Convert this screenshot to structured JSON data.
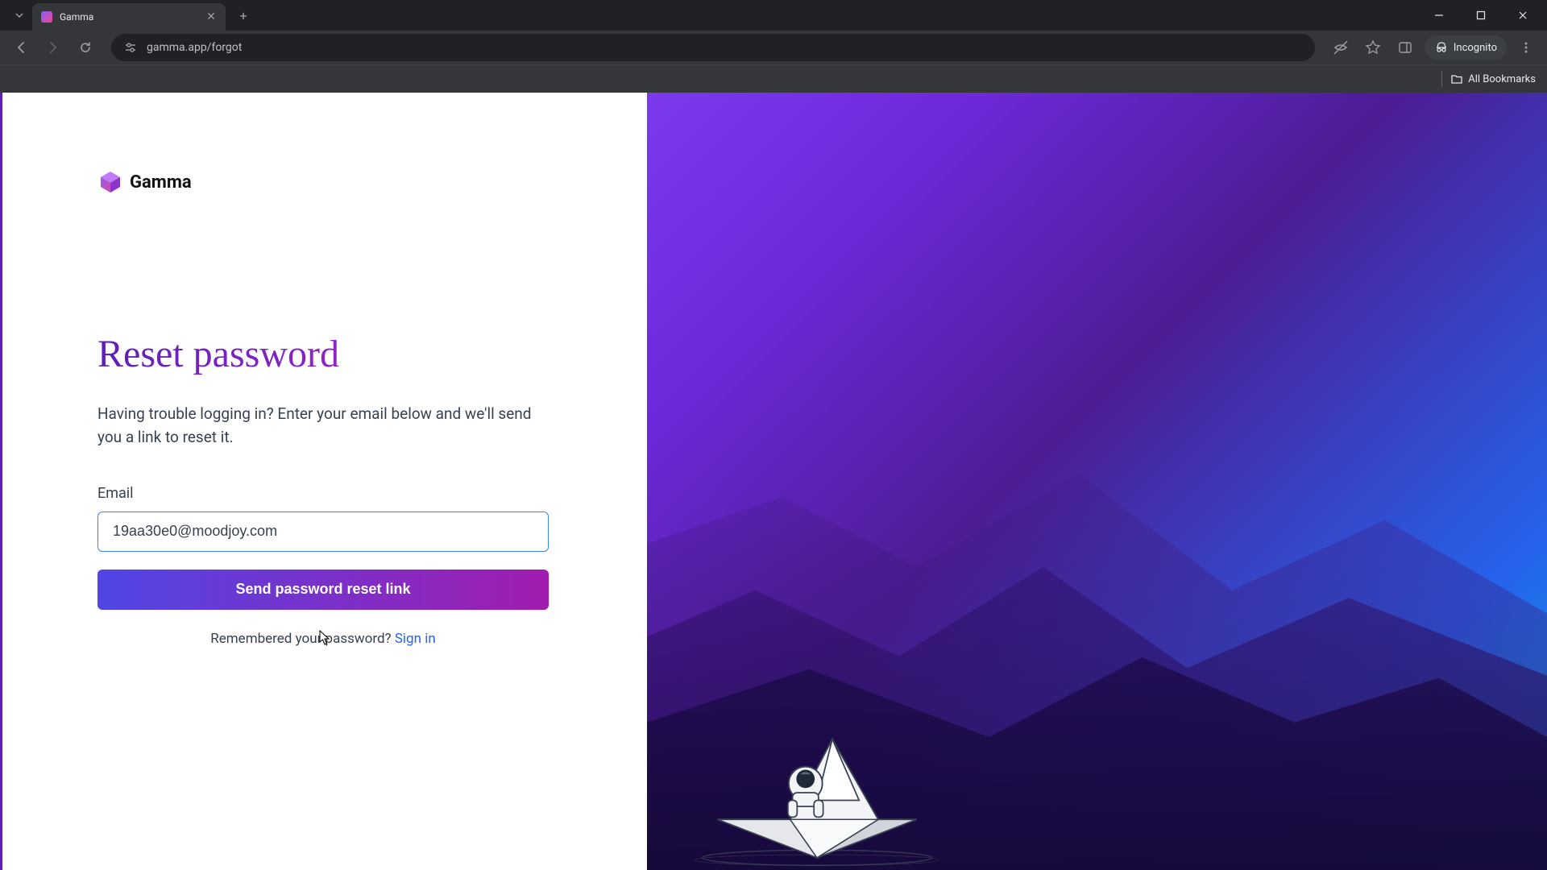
{
  "browser": {
    "tab": {
      "title": "Gamma"
    },
    "url": "gamma.app/forgot",
    "incognito_label": "Incognito",
    "all_bookmarks": "All Bookmarks"
  },
  "logo": {
    "text": "Gamma"
  },
  "form": {
    "heading": "Reset password",
    "subtext": "Having trouble logging in? Enter your email below and we'll send you a link to reset it.",
    "email_label": "Email",
    "email_value": "19aa30e0@moodjoy.com",
    "submit_label": "Send password reset link",
    "remembered_text": "Remembered your password? ",
    "signin_link": "Sign in"
  }
}
